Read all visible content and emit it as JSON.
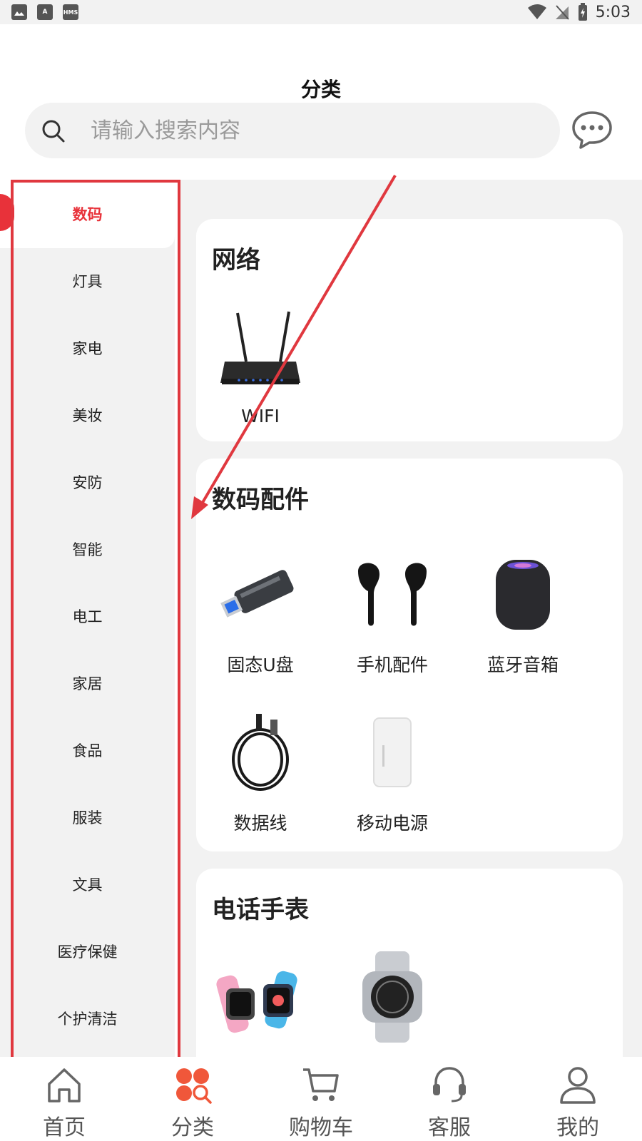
{
  "status_bar": {
    "icons": [
      "image-icon",
      "text-a-icon",
      "hms-icon"
    ],
    "hms_text": "HMS",
    "a_text": "A",
    "time": "5:03"
  },
  "header": {
    "title": "分类"
  },
  "search": {
    "placeholder": "请输入搜索内容"
  },
  "sidebar": {
    "items": [
      {
        "label": "数码",
        "active": true
      },
      {
        "label": "灯具"
      },
      {
        "label": "家电"
      },
      {
        "label": "美妆"
      },
      {
        "label": "安防"
      },
      {
        "label": "智能"
      },
      {
        "label": "电工"
      },
      {
        "label": "家居"
      },
      {
        "label": "食品"
      },
      {
        "label": "服装"
      },
      {
        "label": "文具"
      },
      {
        "label": "医疗保健"
      },
      {
        "label": "个护清洁"
      }
    ]
  },
  "sections": [
    {
      "title": "网络",
      "products": [
        {
          "label": "WIFI",
          "icon": "router-image"
        }
      ]
    },
    {
      "title": "数码配件",
      "products": [
        {
          "label": "固态U盘",
          "icon": "usb-drive-image"
        },
        {
          "label": "手机配件",
          "icon": "earbuds-image"
        },
        {
          "label": "蓝牙音箱",
          "icon": "speaker-image"
        },
        {
          "label": "数据线",
          "icon": "cable-image"
        },
        {
          "label": "移动电源",
          "icon": "power-bank-image"
        }
      ]
    },
    {
      "title": "电话手表",
      "products": [
        {
          "label": "",
          "icon": "kids-watch-image"
        },
        {
          "label": "",
          "icon": "steel-watch-image"
        }
      ]
    }
  ],
  "bottom_nav": {
    "items": [
      {
        "label": "首页",
        "icon": "home-icon"
      },
      {
        "label": "分类",
        "icon": "category-icon",
        "active": true
      },
      {
        "label": "购物车",
        "icon": "cart-icon"
      },
      {
        "label": "客服",
        "icon": "headset-icon"
      },
      {
        "label": "我的",
        "icon": "profile-icon"
      }
    ]
  },
  "colors": {
    "accent": "#e8323a",
    "annotation": "#e0383f",
    "background": "#f2f2f2"
  }
}
